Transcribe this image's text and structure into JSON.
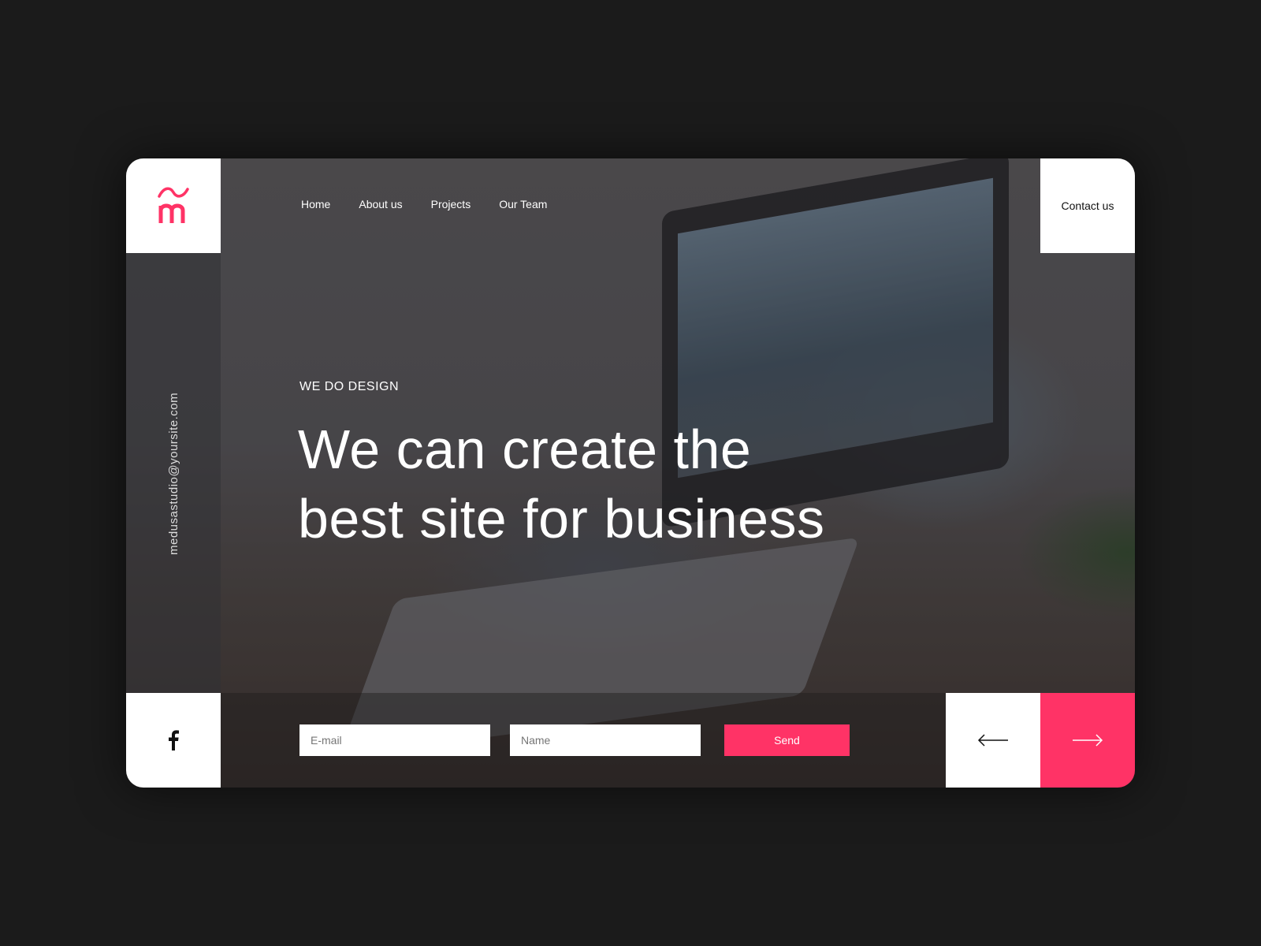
{
  "brand": {
    "logo_letter": "m",
    "accent": "#ff3366"
  },
  "nav": {
    "items": [
      {
        "label": "Home"
      },
      {
        "label": "About us"
      },
      {
        "label": "Projects"
      },
      {
        "label": "Our Team"
      }
    ],
    "contact_label": "Contact us"
  },
  "sidebar": {
    "email": "medusastudio@yoursite.com",
    "social_icon": "facebook-icon"
  },
  "hero": {
    "eyebrow": "WE DO DESIGN",
    "headline_line1": "We can create the",
    "headline_line2": "best site for business"
  },
  "form": {
    "email_placeholder": "E-mail",
    "name_placeholder": "Name",
    "send_label": "Send"
  },
  "slider": {
    "prev_icon": "arrow-left-icon",
    "next_icon": "arrow-right-icon"
  }
}
